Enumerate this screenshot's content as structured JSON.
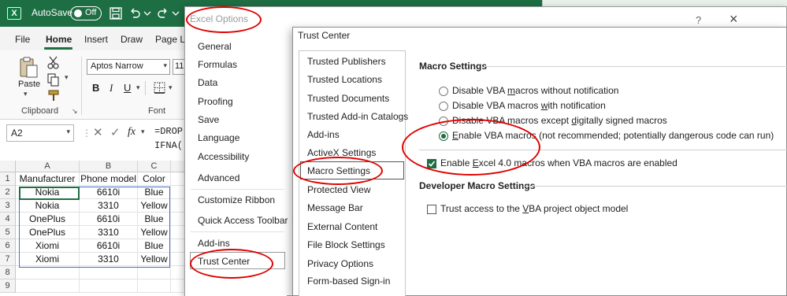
{
  "excel": {
    "logo_letter": "X",
    "autosave_label": "AutoSave",
    "autosave_state": "Off",
    "menu_tabs": [
      "File",
      "Home",
      "Insert",
      "Draw",
      "Page La"
    ],
    "ribbon": {
      "paste_label": "Paste",
      "clipboard_label": "Clipboard",
      "font_label": "Font",
      "font_name": "Aptos Narrow",
      "font_size": "11"
    },
    "name_box": "A2",
    "fx_label": "fx",
    "formula": "=DROP\nIFNA(",
    "columns": [
      "A",
      "B",
      "C"
    ],
    "rows": [
      {
        "num": "1",
        "cells": [
          "Manufacturer",
          "Phone model",
          "Color"
        ]
      },
      {
        "num": "2",
        "cells": [
          "Nokia",
          "6610i",
          "Blue"
        ]
      },
      {
        "num": "3",
        "cells": [
          "Nokia",
          "3310",
          "Yellow"
        ]
      },
      {
        "num": "4",
        "cells": [
          "OnePlus",
          "6610i",
          "Blue"
        ]
      },
      {
        "num": "5",
        "cells": [
          "OnePlus",
          "3310",
          "Yellow"
        ]
      },
      {
        "num": "6",
        "cells": [
          "Xiomi",
          "6610i",
          "Blue"
        ]
      },
      {
        "num": "7",
        "cells": [
          "Xiomi",
          "3310",
          "Yellow"
        ]
      },
      {
        "num": "8",
        "cells": [
          "",
          "",
          ""
        ]
      },
      {
        "num": "9",
        "cells": [
          "",
          "",
          ""
        ]
      }
    ]
  },
  "options_dialog": {
    "title": "Excel Options",
    "help": "?",
    "close": "×",
    "nav": [
      "General",
      "Formulas",
      "Data",
      "Proofing",
      "Save",
      "Language",
      "Accessibility",
      "Advanced",
      "Customize Ribbon",
      "Quick Access Toolbar",
      "Add-ins",
      "Trust Center"
    ],
    "selected": "Trust Center"
  },
  "trust_center": {
    "title": "Trust Center",
    "nav": [
      "Trusted Publishers",
      "Trusted Locations",
      "Trusted Documents",
      "Trusted Add-in Catalogs",
      "Add-ins",
      "ActiveX Settings",
      "Macro Settings",
      "Protected View",
      "Message Bar",
      "External Content",
      "File Block Settings",
      "Privacy Options",
      "Form-based Sign-in"
    ],
    "selected": "Macro Settings",
    "macro_heading": "Macro Settings",
    "radio_options": [
      {
        "pre": "Disable VBA ",
        "key": "m",
        "post": "acros without notification",
        "checked": false
      },
      {
        "pre": "Disable VBA macros ",
        "key": "w",
        "post": "ith notification",
        "checked": false
      },
      {
        "pre": "Disable VBA macros except ",
        "key": "d",
        "post": "igitally signed macros",
        "checked": false
      },
      {
        "pre": "",
        "key": "E",
        "post": "nable VBA macros (not recommended; potentially dangerous code can run)",
        "checked": true
      }
    ],
    "excel4": {
      "pre": "Enable ",
      "key": "E",
      "post": "xcel 4.0 macros when VBA macros are enabled",
      "checked": true
    },
    "developer_heading": "Developer Macro Settings",
    "vba_access": {
      "pre": "Trust access to the ",
      "key": "V",
      "post": "BA project object model",
      "checked": false
    }
  },
  "colors": {
    "excel_green": "#1e6e43",
    "annotation_red": "#e00000",
    "spill_blue": "#4472c4"
  }
}
